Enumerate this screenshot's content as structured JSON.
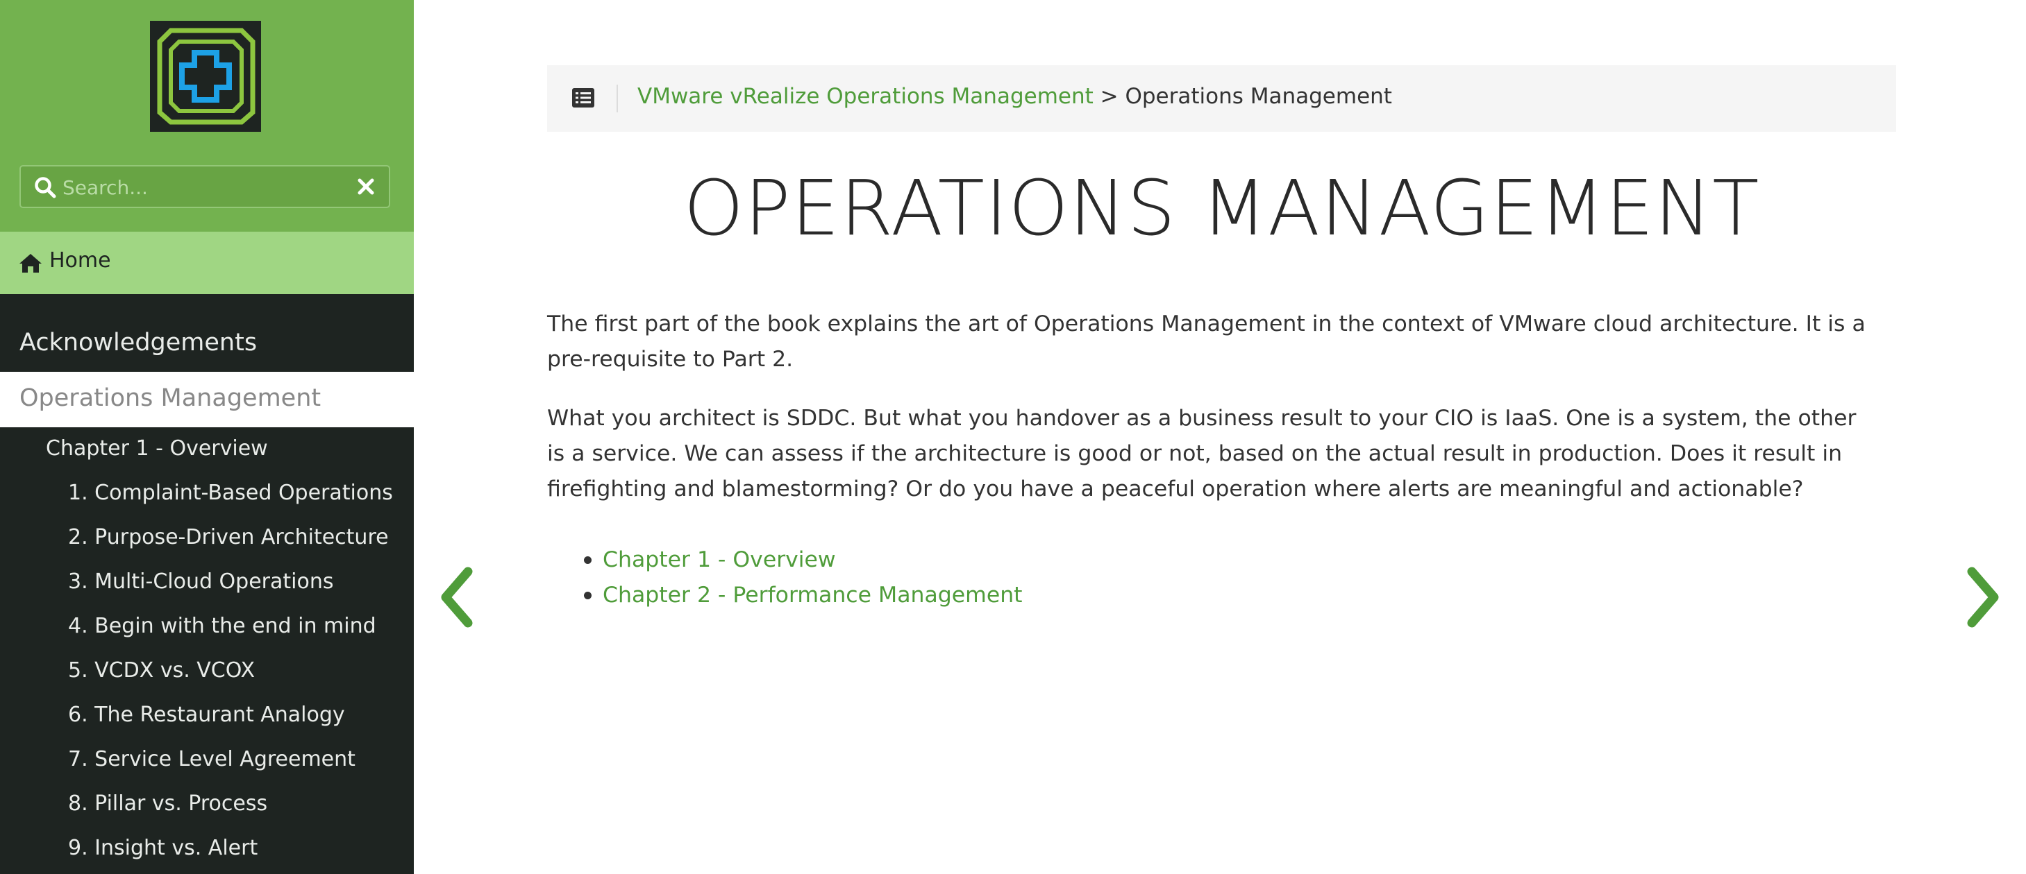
{
  "colors": {
    "brand_green": "#73b24f",
    "home_green": "#a0d683",
    "sidebar_dark": "#1e2421",
    "link_green": "#4f9c3a"
  },
  "sidebar": {
    "logo_icon": "vrealize-logo-icon",
    "search": {
      "placeholder": "Search...",
      "icon": "search-icon",
      "clear_icon": "close-icon"
    },
    "home": {
      "label": "Home",
      "icon": "home-icon"
    },
    "items": [
      {
        "label": "Acknowledgements",
        "level": 1
      },
      {
        "label": "Operations Management",
        "level": 1,
        "active": true
      },
      {
        "label": "Chapter 1 - Overview",
        "level": 2
      },
      {
        "label": "1. Complaint-Based Operations",
        "level": 3
      },
      {
        "label": "2. Purpose-Driven Architecture",
        "level": 3
      },
      {
        "label": "3. Multi-Cloud Operations",
        "level": 3
      },
      {
        "label": "4. Begin with the end in mind",
        "level": 3
      },
      {
        "label": "5. VCDX vs. VCOX",
        "level": 3
      },
      {
        "label": "6. The Restaurant Analogy",
        "level": 3
      },
      {
        "label": "7. Service Level Agreement",
        "level": 3
      },
      {
        "label": "8. Pillar vs. Process",
        "level": 3
      },
      {
        "label": "9. Insight vs. Alert",
        "level": 3
      }
    ]
  },
  "breadcrumb": {
    "icon": "list-icon",
    "parent_link": "VMware vRealize Operations Management",
    "separator": " > ",
    "current": "Operations Management"
  },
  "main": {
    "title": "OPERATIONS MANAGEMENT",
    "paragraphs": [
      "The first part of the book explains the art of Operations Management in the context of VMware cloud architecture. It is a pre-requisite to Part 2.",
      "What you architect is SDDC. But what you handover as a business result to your CIO is IaaS. One is a system, the other is a service. We can assess if the architecture is good or not, based on the actual result in production. Does it result in firefighting and blamestorming? Or do you have a peaceful operation where alerts are meaningful and actionable?"
    ],
    "chapters": [
      "Chapter 1 - Overview",
      "Chapter 2 - Performance Management"
    ]
  },
  "navigation": {
    "prev_icon": "chevron-left-icon",
    "next_icon": "chevron-right-icon"
  }
}
